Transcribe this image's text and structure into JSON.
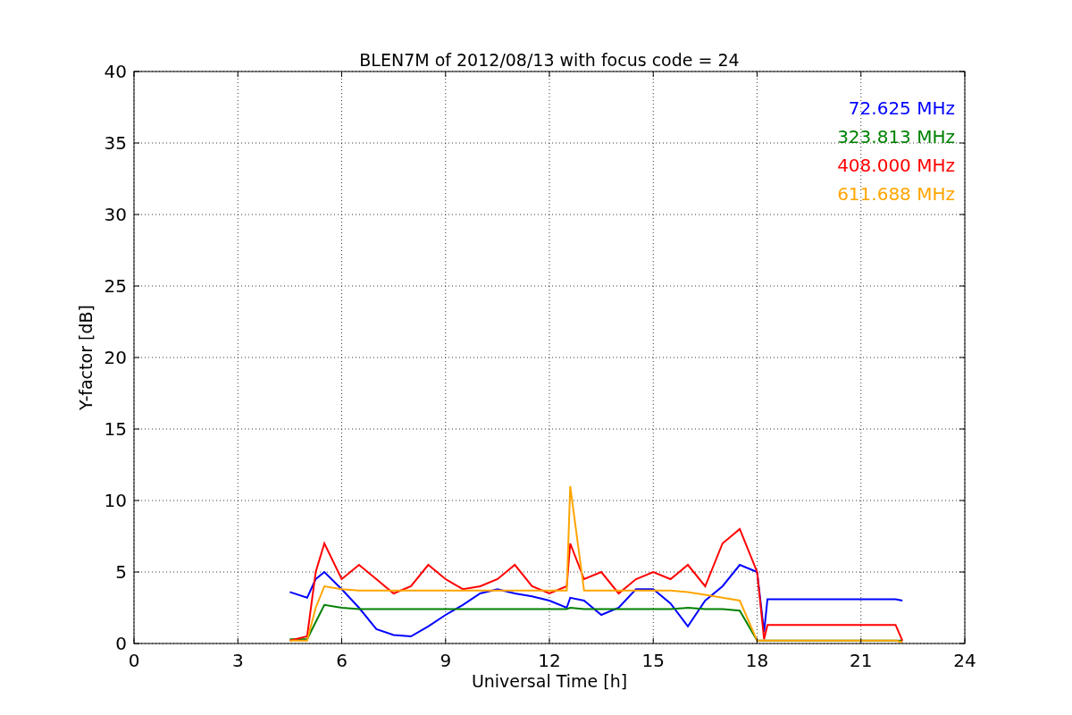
{
  "figure": {
    "chart_data": {
      "type": "line",
      "title": "BLEN7M of 2012/08/13 with focus code = 24",
      "xlabel": "Universal Time [h]",
      "ylabel": "Y-factor [dB]",
      "x": [
        4.5,
        5,
        5.25,
        5.5,
        6,
        6.5,
        7,
        7.5,
        8,
        8.5,
        9,
        9.5,
        10,
        10.5,
        11,
        11.5,
        12,
        12.5,
        12.6,
        13,
        13.5,
        14,
        14.5,
        15,
        15.5,
        16,
        16.5,
        17,
        17.5,
        18,
        18.2,
        18.3,
        22,
        22.2
      ],
      "series": [
        {
          "name": "72.625 MHz",
          "color": "#0000ff",
          "values": [
            3.6,
            3.2,
            4.5,
            5,
            3.8,
            2.5,
            1,
            0.6,
            0.5,
            1.2,
            2,
            2.7,
            3.5,
            3.8,
            3.5,
            3.3,
            3,
            2.5,
            3.2,
            3,
            2,
            2.5,
            3.8,
            3.8,
            2.8,
            1.2,
            3,
            4,
            5.5,
            5,
            0.8,
            3.1,
            3.1,
            3
          ]
        },
        {
          "name": "323.813 MHz",
          "color": "#008000",
          "values": [
            0.3,
            0.3,
            1.5,
            2.7,
            2.5,
            2.4,
            2.4,
            2.4,
            2.4,
            2.4,
            2.4,
            2.4,
            2.4,
            2.4,
            2.4,
            2.4,
            2.4,
            2.4,
            2.5,
            2.4,
            2.4,
            2.4,
            2.4,
            2.4,
            2.4,
            2.5,
            2.4,
            2.4,
            2.3,
            0.2,
            0.2,
            0.2,
            0.2,
            0.2
          ]
        },
        {
          "name": "408.000 MHz",
          "color": "#ff0000",
          "values": [
            0.2,
            0.5,
            5,
            7,
            4.5,
            5.5,
            4.5,
            3.5,
            4,
            5.5,
            4.5,
            3.8,
            4,
            4.5,
            5.5,
            4,
            3.5,
            4,
            7,
            4.5,
            5,
            3.5,
            4.5,
            5,
            4.5,
            5.5,
            4,
            7,
            8,
            5,
            0.3,
            1.3,
            1.3,
            0.2
          ]
        },
        {
          "name": "611.688 MHz",
          "color": "#ffa500",
          "values": [
            0.2,
            0.2,
            2.5,
            4,
            3.8,
            3.7,
            3.7,
            3.7,
            3.7,
            3.7,
            3.7,
            3.7,
            3.7,
            3.7,
            3.7,
            3.7,
            3.7,
            3.7,
            11,
            3.7,
            3.7,
            3.7,
            3.7,
            3.7,
            3.7,
            3.6,
            3.4,
            3.2,
            3,
            0.2,
            0.2,
            0.2,
            0.2,
            0.1
          ]
        }
      ],
      "xlim": [
        0,
        24
      ],
      "ylim": [
        0,
        40
      ],
      "xticks": [
        0,
        3,
        6,
        9,
        12,
        15,
        18,
        21,
        24
      ],
      "yticks": [
        0,
        5,
        10,
        15,
        20,
        25,
        30,
        35,
        40
      ],
      "grid": true
    }
  }
}
